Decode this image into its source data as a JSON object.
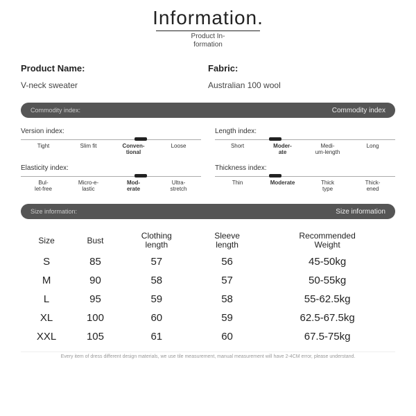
{
  "header": {
    "title": "Information.",
    "subtitle_line1": "Product In-",
    "subtitle_line2": "formation"
  },
  "fields": {
    "name_label": "Product Name:",
    "name_value": "V-neck sweater",
    "fabric_label": "Fabric:",
    "fabric_value": "Australian 100 wool"
  },
  "commodity_bar": {
    "left": "Commodity index:",
    "right": "Commodity index"
  },
  "indexes": {
    "version": {
      "title": "Version index:",
      "opts": [
        "Tight",
        "Slim fit",
        "Conven-\ntional",
        "Loose"
      ],
      "selected": 2
    },
    "length": {
      "title": "Length index:",
      "opts": [
        "Short",
        "Moder-\nate",
        "Medi-\num-length",
        "Long"
      ],
      "selected": 1
    },
    "elasticity": {
      "title": "Elasticity index:",
      "opts": [
        "Bul-\nlet-free",
        "Micro-e-\nlastic",
        "Mod-\nerate",
        "Ultra-\nstretch"
      ],
      "selected": 2
    },
    "thickness": {
      "title": "Thickness index:",
      "opts": [
        "Thin",
        "Moderate",
        "Thick\ntype",
        "Thick-\nened"
      ],
      "selected": 1
    }
  },
  "size_bar": {
    "left": "Size information:",
    "right": "Size information"
  },
  "chart_data": {
    "type": "table",
    "headers": [
      "Size",
      "Bust",
      "Clothing\nlength",
      "Sleeve\nlength",
      "Recommended\nWeight"
    ],
    "rows": [
      [
        "S",
        "85",
        "57",
        "56",
        "45-50kg"
      ],
      [
        "M",
        "90",
        "58",
        "57",
        "50-55kg"
      ],
      [
        "L",
        "95",
        "59",
        "58",
        "55-62.5kg"
      ],
      [
        "XL",
        "100",
        "60",
        "59",
        "62.5-67.5kg"
      ],
      [
        "XXL",
        "105",
        "61",
        "60",
        "67.5-75kg"
      ]
    ]
  },
  "footnote": "Every item of dress different design materials, we use tile measurement, manual measurement will have 2-4CM error, please understand."
}
